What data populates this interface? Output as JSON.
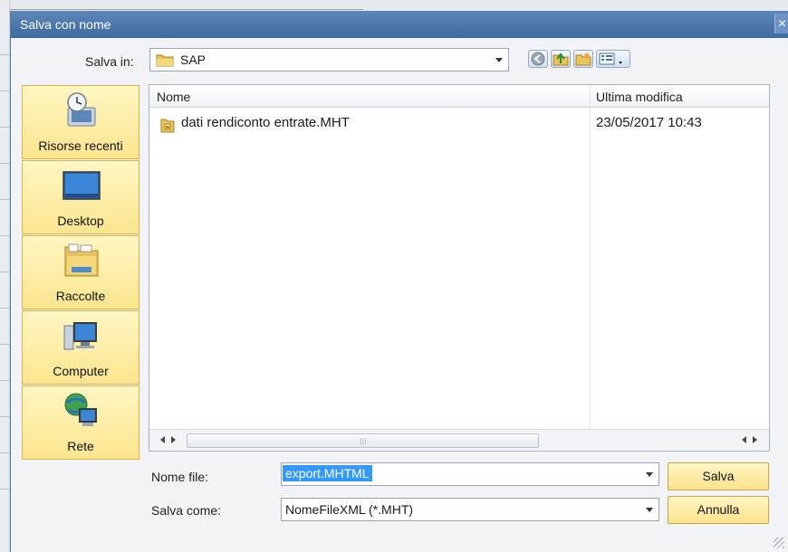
{
  "dialog": {
    "title": "Salva con nome"
  },
  "location": {
    "label_text": "Salva in:",
    "current_folder": "SAP"
  },
  "places": [
    {
      "label": "Risorse recenti",
      "icon": "recent-places-icon"
    },
    {
      "label": "Desktop",
      "icon": "desktop-icon"
    },
    {
      "label": "Raccolte",
      "icon": "libraries-icon"
    },
    {
      "label": "Computer",
      "icon": "computer-icon"
    },
    {
      "label": "Rete",
      "icon": "network-icon"
    }
  ],
  "file_list": {
    "columns": [
      "Nome",
      "Ultima modifica"
    ],
    "rows": [
      {
        "name": "dati rendiconto entrate.MHT",
        "modified": "23/05/2017 10:43",
        "icon": "mht-file-icon"
      }
    ]
  },
  "filename": {
    "label_text": "Nome file:",
    "value": "export.MHTML"
  },
  "filetype": {
    "label_text": "Salva come:",
    "value": "NomeFileXML (*.MHT)"
  },
  "buttons": {
    "save": "Salva",
    "cancel": "Annulla"
  },
  "toolbar_icons": [
    "back-icon",
    "up-folder-icon",
    "new-folder-icon",
    "view-menu-icon"
  ],
  "colors": {
    "title_bar": "#4f78ad",
    "places_fill": "#fbe58e",
    "selection": "#3399ff"
  }
}
